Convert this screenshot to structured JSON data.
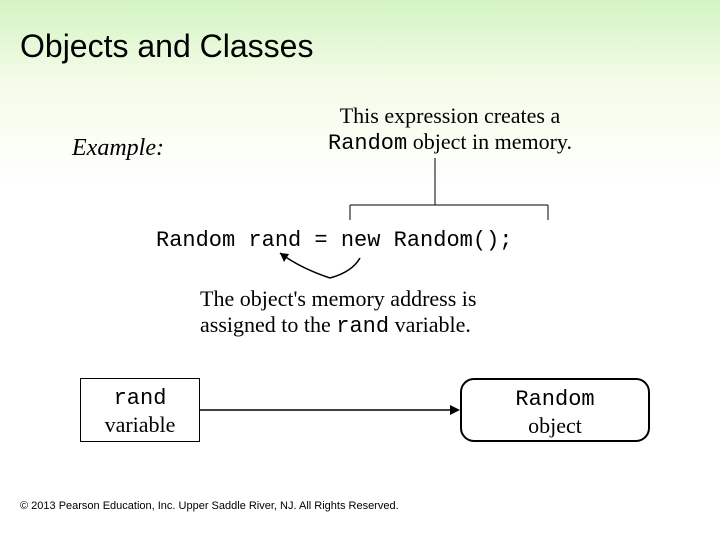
{
  "title": "Objects and Classes",
  "example_label": "Example:",
  "top_annotation": {
    "line1": "This expression creates a",
    "code": "Random",
    "line2_rest": " object in memory."
  },
  "code": {
    "type": "Random",
    "var": "rand",
    "eq": " = ",
    "expr": "new Random();"
  },
  "bottom_annotation": {
    "line1": "The object's memory address is",
    "line2_pre": "assigned to the ",
    "code": "rand",
    "line2_post": "  variable."
  },
  "rand_box": {
    "code": "rand",
    "label": "variable"
  },
  "random_box": {
    "code": "Random",
    "label": "object"
  },
  "copyright": "© 2013 Pearson Education, Inc. Upper Saddle River, NJ. All Rights Reserved."
}
